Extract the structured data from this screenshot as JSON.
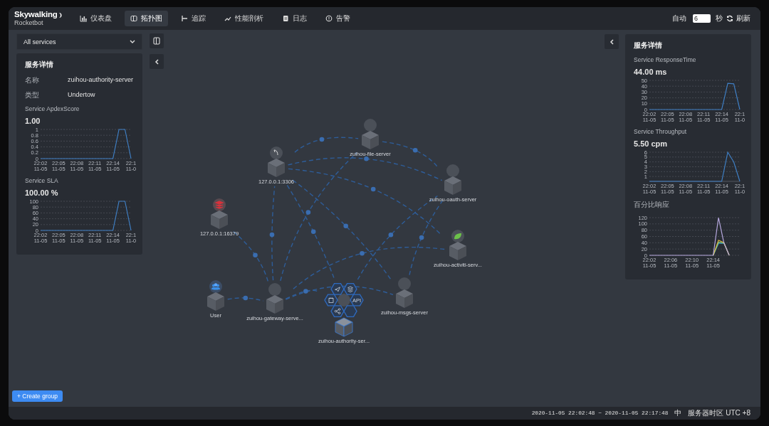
{
  "header": {
    "logo": "Skywalking",
    "logo_sub": "Rocketbot",
    "nav": [
      {
        "label": "仪表盘",
        "selected": false
      },
      {
        "label": "拓扑图",
        "selected": true
      },
      {
        "label": "追踪",
        "selected": false
      },
      {
        "label": "性能剖析",
        "selected": false
      },
      {
        "label": "日志",
        "selected": false
      },
      {
        "label": "告警",
        "selected": false
      }
    ],
    "auto_label": "自动",
    "interval": "6",
    "interval_unit": "秒",
    "refresh": "刷新"
  },
  "left_panel": {
    "service_select": "All services",
    "title": "服务详情",
    "fields": [
      {
        "label": "名称",
        "value": "zuihou-authority-server"
      },
      {
        "label": "类型",
        "value": "Undertow"
      }
    ],
    "metrics": [
      {
        "title": "Service ApdexScore",
        "value": "1.00",
        "chart_data": {
          "type": "line",
          "categories": [
            "22:02\n11-05",
            null,
            null,
            "22:05\n11-05",
            null,
            null,
            "22:08\n11-05",
            null,
            null,
            "22:11\n11-05",
            null,
            null,
            "22:14\n11-05",
            null,
            null,
            "22:1\n11-0"
          ],
          "grid": true,
          "ylim": [
            0,
            1
          ],
          "yticks": [
            0,
            0.2,
            0.4,
            0.6,
            0.8,
            1
          ],
          "series": [
            {
              "color": "#3f7fc4",
              "values": [
                0,
                0,
                0,
                0,
                0,
                0,
                0,
                0,
                0,
                0,
                0,
                0,
                0,
                1,
                1,
                0
              ]
            }
          ]
        }
      },
      {
        "title": "Service SLA",
        "value": "100.00 %",
        "chart_data": {
          "type": "line",
          "categories": [
            "22:02\n11-05",
            null,
            null,
            "22:05\n11-05",
            null,
            null,
            "22:08\n11-05",
            null,
            null,
            "22:11\n11-05",
            null,
            null,
            "22:14\n11-05",
            null,
            null,
            "22:1\n11-0"
          ],
          "grid": true,
          "ylim": [
            0,
            100
          ],
          "yticks": [
            0,
            20,
            40,
            60,
            80,
            100
          ],
          "series": [
            {
              "color": "#3f7fc4",
              "values": [
                0,
                0,
                0,
                0,
                0,
                0,
                0,
                0,
                0,
                0,
                0,
                0,
                0,
                100,
                100,
                0
              ]
            }
          ]
        }
      }
    ]
  },
  "right_panel": {
    "title": "服务详情",
    "metrics": [
      {
        "title": "Service ResponseTime",
        "value": "44.00 ms",
        "chart_data": {
          "type": "line",
          "categories": [
            "22:02\n11-05",
            null,
            null,
            "22:05\n11-05",
            null,
            null,
            "22:08\n11-05",
            null,
            null,
            "22:11\n11-05",
            null,
            null,
            "22:14\n11-05",
            null,
            null,
            "22:1\n11-0"
          ],
          "grid": true,
          "ylim": [
            0,
            50
          ],
          "yticks": [
            0,
            10,
            20,
            30,
            40,
            50
          ],
          "series": [
            {
              "color": "#3f7fc4",
              "values": [
                0,
                0,
                0,
                0,
                0,
                0,
                0,
                0,
                0,
                0,
                0,
                0,
                0,
                45,
                44,
                0
              ]
            }
          ]
        }
      },
      {
        "title": "Service Throughput",
        "value": "5.50 cpm",
        "chart_data": {
          "type": "line",
          "categories": [
            "22:02\n11-05",
            null,
            null,
            "22:05\n11-05",
            null,
            null,
            "22:08\n11-05",
            null,
            null,
            "22:11\n11-05",
            null,
            null,
            "22:14\n11-05",
            null,
            null,
            "22:1\n11-0"
          ],
          "grid": true,
          "ylim": [
            0,
            6
          ],
          "yticks": [
            1,
            2,
            3,
            4,
            5,
            6
          ],
          "series": [
            {
              "color": "#3f7fc4",
              "values": [
                0,
                0,
                0,
                0,
                0,
                0,
                0,
                0,
                0,
                0,
                0,
                0,
                0,
                6,
                4,
                0
              ]
            }
          ]
        }
      },
      {
        "title": "百分比响应",
        "chart_data": {
          "type": "line",
          "categories": [
            "22:02\n11-05",
            null,
            null,
            null,
            "22:06\n11-05",
            null,
            null,
            null,
            "22:10\n11-05",
            null,
            null,
            null,
            "22:14\n11-05",
            null,
            null,
            null,
            null,
            null
          ],
          "grid": true,
          "ylim": [
            0,
            120
          ],
          "yticks": [
            0,
            20,
            40,
            60,
            80,
            100,
            120
          ],
          "series": [
            {
              "color": "#3ea0c8",
              "values": [
                null,
                null,
                null,
                null,
                null,
                null,
                null,
                null,
                null,
                null,
                null,
                null,
                0,
                38,
                38,
                null,
                null,
                null
              ]
            },
            {
              "color": "#7fc97f",
              "values": [
                null,
                null,
                null,
                null,
                null,
                null,
                null,
                null,
                null,
                null,
                null,
                null,
                0,
                42,
                40,
                0,
                null,
                null
              ]
            },
            {
              "color": "#d9b340",
              "values": [
                null,
                null,
                null,
                null,
                null,
                null,
                null,
                null,
                null,
                null,
                null,
                null,
                0,
                48,
                40,
                0,
                null,
                null
              ]
            },
            {
              "color": "#b7a9e0",
              "values": [
                0,
                0,
                0,
                0,
                0,
                0,
                0,
                0,
                0,
                0,
                0,
                0,
                0,
                120,
                40,
                0,
                null,
                null
              ]
            }
          ]
        }
      }
    ]
  },
  "topology": {
    "nodes": [
      {
        "name": "127.0.0.1:3306",
        "kind": "database",
        "selected": false
      },
      {
        "name": "zuihou-file-server",
        "kind": "service",
        "selected": false
      },
      {
        "name": "zuihou-oauth-server",
        "kind": "service",
        "selected": false
      },
      {
        "name": "127.0.0.1:16379",
        "kind": "cache",
        "selected": false
      },
      {
        "name": "zuihou-activiti-serv...",
        "kind": "framework",
        "selected": false
      },
      {
        "name": "User",
        "kind": "user",
        "selected": false
      },
      {
        "name": "zuihou-gateway-serve...",
        "kind": "service",
        "selected": false
      },
      {
        "name": "zuihou-msgs-server",
        "kind": "service",
        "selected": false
      },
      {
        "name": "zuihou-authority-ser...",
        "kind": "service",
        "selected": true
      }
    ],
    "node_menu": [
      {
        "kind": "send"
      },
      {
        "kind": "layers"
      },
      {
        "kind": "clipboard"
      },
      {
        "kind": "text",
        "label": "API"
      },
      {
        "kind": "share"
      },
      {
        "kind": "blank"
      }
    ]
  },
  "create_group": "+ Create group",
  "footer": {
    "time_range": "2020-11-05 22:02:48 ~ 2020-11-05 22:17:48",
    "language": "中",
    "timezone": "服务器时区 UTC +8"
  }
}
